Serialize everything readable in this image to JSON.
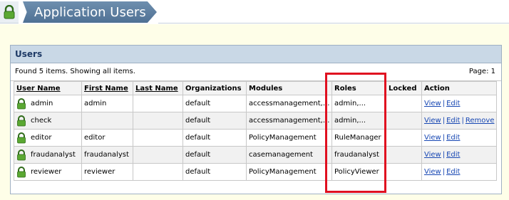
{
  "header": {
    "title": "Application Users",
    "icon": "lock-icon",
    "accent": "#5f80a4"
  },
  "panel": {
    "title": "Users",
    "status": "Found 5 items. Showing all items.",
    "page": "Page: 1"
  },
  "table": {
    "columns": [
      "User Name",
      "First Name",
      "Last Name",
      "Organizations",
      "Modules",
      "Roles",
      "Locked",
      "Action"
    ],
    "rows": [
      {
        "user": "admin",
        "first": "admin",
        "last": "",
        "org": "default",
        "modules": "accessmanagement,...",
        "roles": "admin,...",
        "locked": "",
        "actions": [
          "View",
          "Edit"
        ]
      },
      {
        "user": "check",
        "first": "",
        "last": "",
        "org": "default",
        "modules": "accessmanagement,...",
        "roles": "admin,...",
        "locked": "",
        "actions": [
          "View",
          "Edit",
          "Remove"
        ]
      },
      {
        "user": "editor",
        "first": "editor",
        "last": "",
        "org": "default",
        "modules": "PolicyManagement",
        "roles": "RuleManager",
        "locked": "",
        "actions": [
          "View",
          "Edit"
        ]
      },
      {
        "user": "fraudanalyst",
        "first": "fraudanalyst",
        "last": "",
        "org": "default",
        "modules": "casemanagement",
        "roles": "fraudanalyst",
        "locked": "",
        "actions": [
          "View",
          "Edit"
        ]
      },
      {
        "user": "reviewer",
        "first": "reviewer",
        "last": "",
        "org": "default",
        "modules": "PolicyManagement",
        "roles": "PolicyViewer",
        "locked": "",
        "actions": [
          "View",
          "Edit"
        ]
      }
    ]
  },
  "colors": {
    "highlight": "#e01020",
    "link": "#1747b3",
    "icon_green": "#4c9a2a"
  }
}
